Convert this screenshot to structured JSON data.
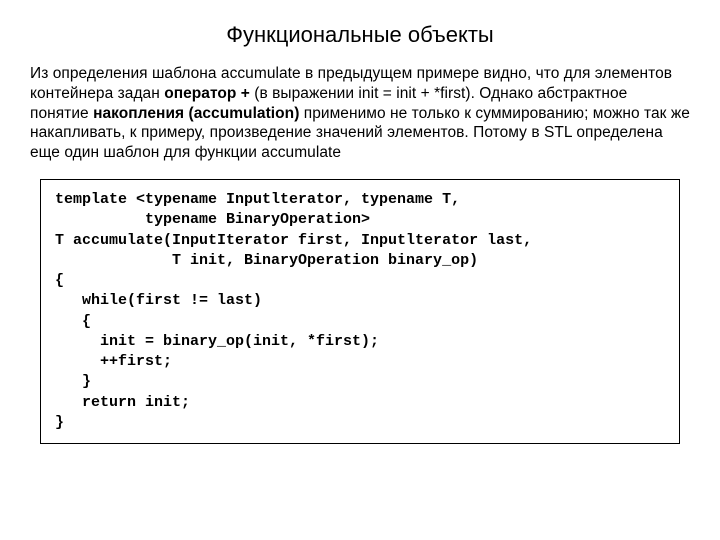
{
  "title": "Функциональные объекты",
  "paragraph_html": "Из определения шаблона accumulate в предыдущем примере видно, что для элементов контейнера задан <b>оператор +</b> (в выражении init = init + *first). Однако абстрактное понятие <b>накопления (accumulation)</b> применимо не только к суммированию; можно так же накапливать, к примеру, произведение значений элементов. Потому в STL определена еще один шаблон для функции accumulate",
  "code": "template <typename Inputlterator, typename T,\n          typename BinaryOperation>\nT accumulate(InputIterator first, Inputlterator last,\n             T init, BinaryOperation binary_op)\n{\n   while(first != last)\n   {\n     init = binary_op(init, *first);\n     ++first;\n   }\n   return init;\n}"
}
